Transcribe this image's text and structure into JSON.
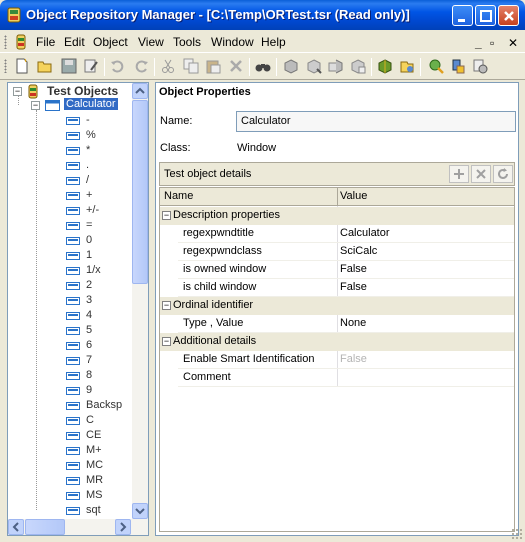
{
  "window": {
    "title": "Object Repository Manager - [C:\\Temp\\ORTest.tsr (Read only)]"
  },
  "menubar": {
    "items": [
      {
        "label": "File"
      },
      {
        "label": "Edit"
      },
      {
        "label": "Object"
      },
      {
        "label": "View"
      },
      {
        "label": "Tools"
      },
      {
        "label": "Window"
      },
      {
        "label": "Help"
      }
    ]
  },
  "toolbar": {
    "icons": [
      "new-icon",
      "open-icon",
      "save-icon",
      "edit-icon",
      "undo-icon",
      "redo-icon",
      "cut-icon",
      "copy-icon",
      "paste-icon",
      "delete-icon",
      "find-icon",
      "add-object-icon",
      "object-spy-icon",
      "navigate-icon",
      "highlight-icon",
      "add-to-repository-icon",
      "merge-icon",
      "update-icon",
      "define-object-icon"
    ]
  },
  "tree": {
    "root": "Test Objects",
    "parent": "Calculator",
    "children": [
      "-",
      "%",
      "*",
      ".",
      "/",
      "+",
      "+/-",
      "=",
      "0",
      "1",
      "1/x",
      "2",
      "3",
      "4",
      "5",
      "6",
      "7",
      "8",
      "9",
      "Backsp",
      "C",
      "CE",
      "M+",
      "MC",
      "MR",
      "MS",
      "sqt"
    ]
  },
  "properties": {
    "section_title": "Object Properties",
    "name_label": "Name:",
    "name_value": "Calculator",
    "class_label": "Class:",
    "class_value": "Window",
    "details_title": "Test object details",
    "columns": {
      "name": "Name",
      "value": "Value"
    },
    "groups": [
      {
        "title": "Description properties",
        "rows": [
          {
            "name": "regexpwndtitle",
            "value": "Calculator",
            "disabled": false
          },
          {
            "name": "regexpwndclass",
            "value": "SciCalc",
            "disabled": false
          },
          {
            "name": "is owned window",
            "value": "False",
            "disabled": false
          },
          {
            "name": "is child window",
            "value": "False",
            "disabled": false
          }
        ]
      },
      {
        "title": "Ordinal identifier",
        "rows": [
          {
            "name": "Type , Value",
            "value": "None",
            "disabled": false
          }
        ]
      },
      {
        "title": "Additional details",
        "rows": [
          {
            "name": "Enable Smart Identification",
            "value": "False",
            "disabled": true
          },
          {
            "name": "Comment",
            "value": "",
            "disabled": false
          }
        ]
      }
    ]
  }
}
